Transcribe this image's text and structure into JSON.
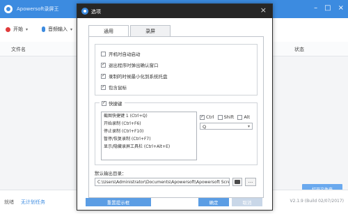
{
  "app": {
    "title": "Apowersoft录屏王",
    "toolbar": {
      "start_label": "开始",
      "audio_label": "音频输入"
    },
    "columns": {
      "filename": "文件名",
      "status": "状态"
    },
    "footer": {
      "left_text": "就绪",
      "task_link": "无计划任务"
    },
    "bg_buttons": {
      "b1": "打开文件夹"
    },
    "version": "V2.1.9 (Build 02/07/2017)"
  },
  "dialog": {
    "title": "选项",
    "tabs": [
      {
        "label": "通用"
      },
      {
        "label": "录屏"
      }
    ],
    "general_options": [
      {
        "label": "开机时自动启动",
        "checked": false
      },
      {
        "label": "退出程序时弹出确认窗口",
        "checked": true
      },
      {
        "label": "录制的时候最小化到系统托盘",
        "checked": true
      },
      {
        "label": "包含鼠标",
        "checked": true
      }
    ],
    "hotkeys": {
      "legend": "快捷键",
      "enabled": true,
      "items": [
        "截图快捷键 1 (Ctrl+Q)",
        "开始录制 (Ctrl+F6)",
        "停止录制 (Ctrl+F10)",
        "暂停/恢复录制 (Ctrl+F7)",
        "显示/隐藏录屏工具栏 (Ctrl+Alt+E)"
      ],
      "modifiers": [
        {
          "label": "Ctrl",
          "checked": true
        },
        {
          "label": "Shift",
          "checked": false
        },
        {
          "label": "Alt",
          "checked": false
        }
      ],
      "key_value": "Q"
    },
    "output": {
      "label": "默认输出目录：",
      "path": "C:\\Users\\Administrator\\Documents\\Apowersoft\\Apowersoft Scre",
      "more_label": "..."
    },
    "buttons": {
      "reset": "重置提示框",
      "ok": "确定",
      "cancel": "取消"
    }
  },
  "colors": {
    "accent": "#3c8be0",
    "dialog_title_bg": "#262626",
    "button_blue": "#5b9de4"
  }
}
